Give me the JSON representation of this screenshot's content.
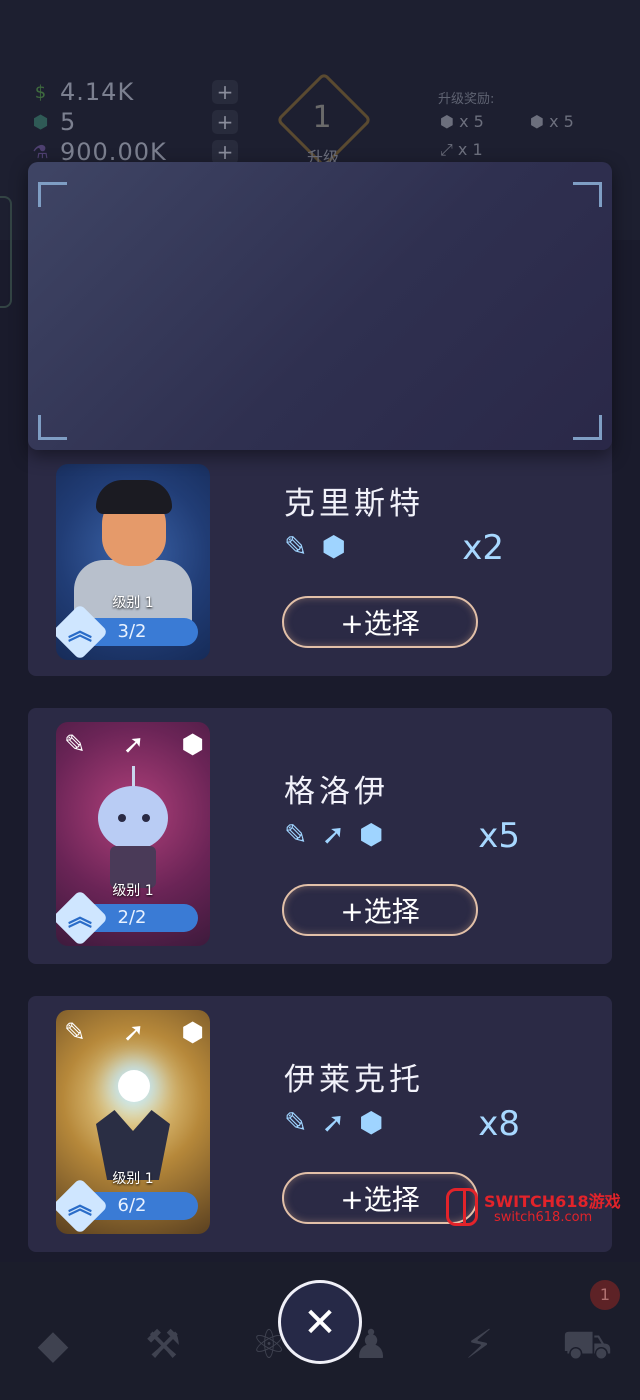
{
  "resources": {
    "money": "4.14K",
    "gems": "5",
    "flask": "900.00K",
    "plus": "+"
  },
  "level": {
    "number": "1",
    "label": "升级"
  },
  "rewards": {
    "title": "升级奖励:",
    "items": [
      "x 5",
      "x 5",
      "x 1"
    ]
  },
  "characters": [
    {
      "name": "克里斯特",
      "multiplier": "x2",
      "level_label": "级别 1",
      "progress": "3/2",
      "select_label": "+选择",
      "icons": [
        "syringe-icon",
        "cubes-icon"
      ]
    },
    {
      "name": "格洛伊",
      "multiplier": "x5",
      "level_label": "级别 1",
      "progress": "2/2",
      "select_label": "+选择",
      "icons": [
        "syringe-icon",
        "arrow-icon",
        "cubes-icon"
      ]
    },
    {
      "name": "伊莱克托",
      "multiplier": "x8",
      "level_label": "级别 1",
      "progress": "6/2",
      "select_label": "+选择",
      "icons": [
        "syringe-icon",
        "arrow-icon",
        "cubes-icon"
      ]
    }
  ],
  "notification_count": "1",
  "close_symbol": "✕",
  "watermark": {
    "title": "SWITCH618游戏",
    "url": "switch618.com"
  },
  "colors": {
    "accent_blue": "#3a7bd5",
    "button_border": "#e2c0a8",
    "watermark_red": "#e2232a"
  }
}
